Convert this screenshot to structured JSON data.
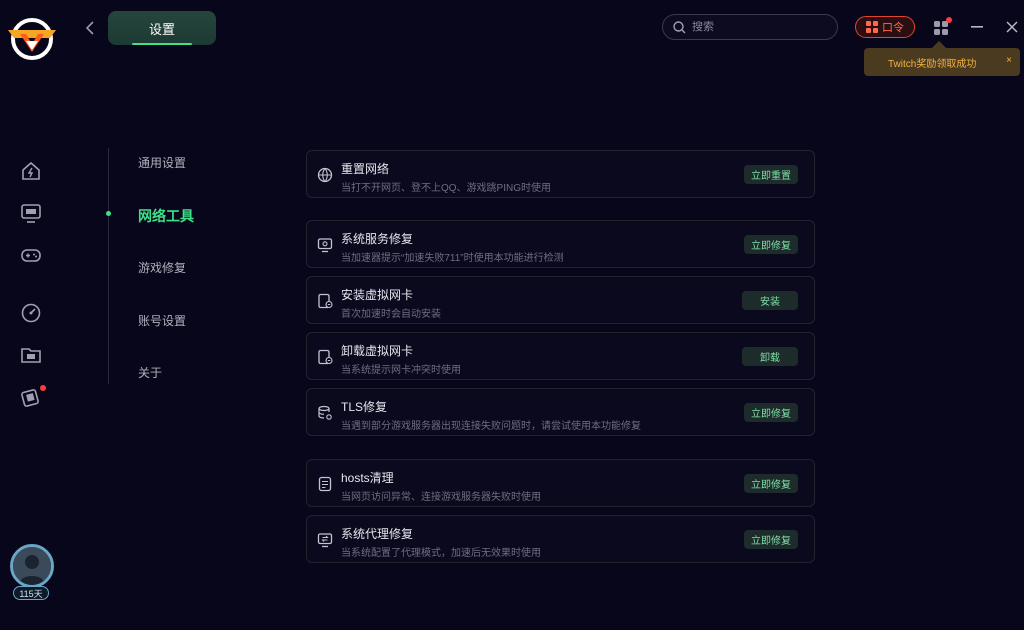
{
  "header": {
    "title": "设置",
    "search_placeholder": "搜索",
    "kouling_label": "口令"
  },
  "toast": {
    "message": "Twitch奖励领取成功",
    "close": "×"
  },
  "user": {
    "days_badge": "115天"
  },
  "settings_nav": {
    "items": [
      {
        "label": "通用设置"
      },
      {
        "label": "网络工具"
      },
      {
        "label": "游戏修复"
      },
      {
        "label": "账号设置"
      },
      {
        "label": "关于"
      }
    ],
    "active_index": 1
  },
  "tools": [
    {
      "title": "重置网络",
      "desc": "当打不开网页、登不上QQ、游戏跳PING时使用",
      "action": "立即重置",
      "icon": "globe-reset-icon"
    },
    {
      "title": "系统服务修复",
      "desc": "当加速器提示“加速失败711”时使用本功能进行检测",
      "action": "立即修复",
      "icon": "monitor-service-icon"
    },
    {
      "title": "安装虚拟网卡",
      "desc": "首次加速时会自动安装",
      "action": "安装",
      "icon": "network-card-icon"
    },
    {
      "title": "卸载虚拟网卡",
      "desc": "当系统提示网卡冲突时使用",
      "action": "卸载",
      "icon": "network-card-icon"
    },
    {
      "title": "TLS修复",
      "desc": "当遇到部分游戏服务器出现连接失败问题时，请尝试使用本功能修复",
      "action": "立即修复",
      "icon": "database-gear-icon"
    },
    {
      "title": "hosts清理",
      "desc": "当网页访问异常、连接游戏服务器失败时使用",
      "action": "立即修复",
      "icon": "hosts-file-icon"
    },
    {
      "title": "系统代理修复",
      "desc": "当系统配置了代理模式，加速后无效果时使用",
      "action": "立即修复",
      "icon": "proxy-monitor-icon"
    }
  ],
  "colors": {
    "background": "#07061a",
    "accent": "#3ee08a",
    "danger": "#e2452f",
    "toast": "#f5b342"
  }
}
